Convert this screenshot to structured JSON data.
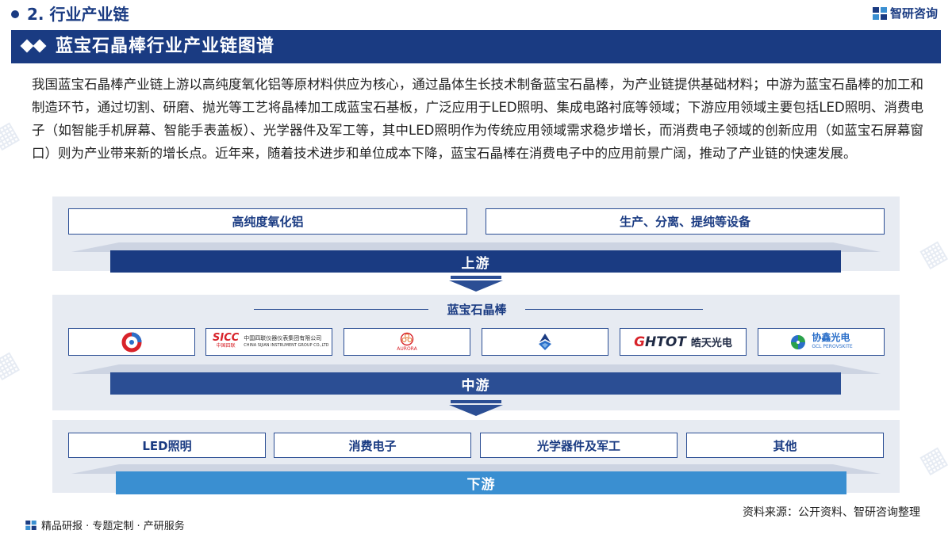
{
  "section": {
    "title": "2. 行业产业链"
  },
  "brand": {
    "name": "智研咨询"
  },
  "header": {
    "title": "蓝宝石晶棒行业产业链图谱"
  },
  "intro": "我国蓝宝石晶棒产业链上游以高纯度氧化铝等原材料供应为核心，通过晶体生长技术制备蓝宝石晶棒，为产业链提供基础材料；中游为蓝宝石晶棒的加工和制造环节，通过切割、研磨、抛光等工艺将晶棒加工成蓝宝石基板，广泛应用于LED照明、集成电路衬底等领域；下游应用领域主要包括LED照明、消费电子（如智能手机屏幕、智能手表盖板）、光学器件及军工等，其中LED照明作为传统应用领域需求稳步增长，而消费电子领域的创新应用（如蓝宝石屏幕窗口）则为产业带来新的增长点。近年来，随着技术进步和单位成本下降，蓝宝石晶棒在消费电子中的应用前景广阔，推动了产业链的快速发展。",
  "upstream": {
    "items": [
      "高纯度氧化铝",
      "生产、分离、提纯等设备"
    ],
    "label": "上游"
  },
  "midstream": {
    "title": "蓝宝石晶棒",
    "label": "中游",
    "logos": [
      {
        "icon": "red-blue-ring-logo-icon"
      },
      {
        "mark": "SICC",
        "sub": "中国四联",
        "cn": "中国四联仪器仪表集团有限公司",
        "en": "CHINA SIJIAN INSTRUMENT GROUP CO.,LTD"
      },
      {
        "icon": "aurora-flower-logo-icon",
        "en": "AURORA"
      },
      {
        "icon": "blue-drop-logo-icon"
      },
      {
        "mark": "HTOT",
        "cn": "皓天光电"
      },
      {
        "cn": "协鑫光电",
        "en": "GCL PEROVSKITE"
      }
    ]
  },
  "downstream": {
    "items": [
      "LED照明",
      "消费电子",
      "光学器件及军工",
      "其他"
    ],
    "label": "下游"
  },
  "source": "资料来源：公开资料、智研咨询整理",
  "footer": "精品研报 · 专题定制 · 产研服务",
  "colors": {
    "navy": "#1a3b82",
    "midblue": "#2b4e94",
    "lightblue": "#3a8fd1",
    "panel": "#e7ebf2",
    "red": "#d8232a"
  }
}
